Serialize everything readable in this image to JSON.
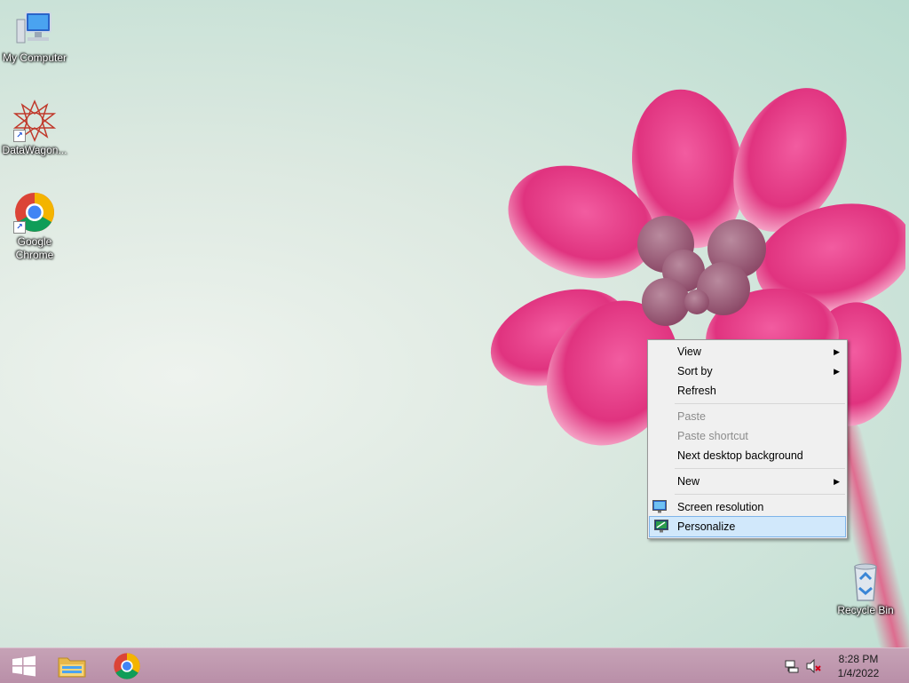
{
  "desktop": {
    "icons": [
      {
        "label": "My Computer",
        "icon": "computer-icon"
      },
      {
        "label": "DataWagon...",
        "icon": "datawagon-icon"
      },
      {
        "label": "Google Chrome",
        "icon": "chrome-icon"
      },
      {
        "label": "Recycle Bin",
        "icon": "recycle-bin-icon"
      }
    ]
  },
  "context_menu": {
    "items": [
      {
        "label": "View",
        "submenu": true
      },
      {
        "label": "Sort by",
        "submenu": true
      },
      {
        "label": "Refresh"
      },
      {
        "label": "Paste",
        "disabled": true
      },
      {
        "label": "Paste shortcut",
        "disabled": true
      },
      {
        "label": "Next desktop background"
      },
      {
        "label": "New",
        "submenu": true
      },
      {
        "label": "Screen resolution",
        "icon": "monitor-icon"
      },
      {
        "label": "Personalize",
        "icon": "personalize-icon",
        "highlighted": true
      }
    ]
  },
  "taskbar": {
    "pinned": [
      "start-icon",
      "file-explorer-icon",
      "chrome-icon"
    ],
    "tray_icons": [
      "network-icon",
      "volume-muted-icon"
    ],
    "clock": {
      "time": "8:28 PM",
      "date": "1/4/2022"
    }
  },
  "colors": {
    "menu_highlight": "#d1e8fb",
    "taskbar": "#c6a2b6",
    "flower": "#e8438f"
  }
}
